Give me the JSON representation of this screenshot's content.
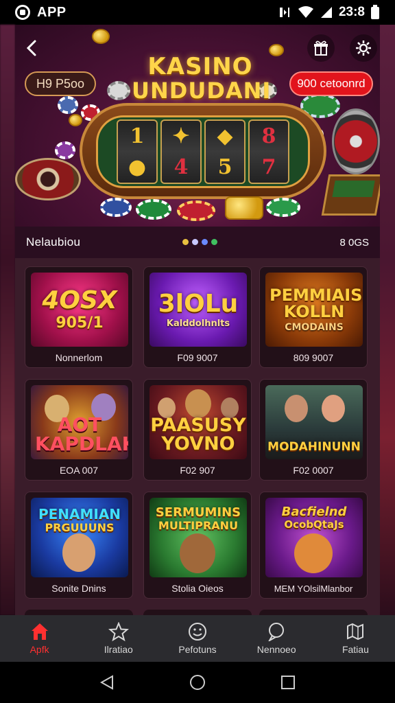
{
  "status_bar": {
    "app_name": "APP",
    "time": "23:8"
  },
  "header": {
    "title_line1": "KASINO",
    "title_line2": "UNDUDANI",
    "pill_left": "H9 P5oo",
    "pill_right": "900 cetoonrd"
  },
  "section": {
    "label": "Nelaubiou",
    "count": "8 0GS",
    "dots": [
      "#e8c040",
      "#c8c8ff",
      "#6a8aff",
      "#40c060"
    ]
  },
  "games": [
    {
      "title": "4OSX",
      "subtitle": "905/1",
      "name": "Nonnerlom"
    },
    {
      "title": "3lOLu",
      "subtitle": "Kalddolhnlts",
      "name": "F09 9007"
    },
    {
      "title": "PEMMIAISN KOLLN",
      "subtitle": "CMODAINS",
      "name": "809 9007"
    },
    {
      "title": "AOT KAPDLAK",
      "subtitle": "",
      "name": "EOA 007"
    },
    {
      "title": "PAASUSY YOVNO",
      "subtitle": "",
      "name": "F02 907"
    },
    {
      "title": "MODAHINUNN",
      "subtitle": "",
      "name": "F02 0007"
    },
    {
      "title": "PENAMIAN",
      "subtitle": "PRGUUUNS",
      "name": "Sonite Dnins"
    },
    {
      "title": "SERMUMINS",
      "subtitle": "MULTIPRANU",
      "name": "Stolia Oieos"
    },
    {
      "title": "Bacfielnd",
      "subtitle": "OcobQtaJs",
      "name": "MEM YOlsilMlanbor"
    }
  ],
  "bottom_nav": [
    {
      "label": "Apfk",
      "icon": "home-icon",
      "active": true
    },
    {
      "label": "Ilratiao",
      "icon": "star-icon",
      "active": false
    },
    {
      "label": "Pefotuns",
      "icon": "smile-icon",
      "active": false
    },
    {
      "label": "Nennoeo",
      "icon": "chat-icon",
      "active": false
    },
    {
      "label": "Fatiau",
      "icon": "map-icon",
      "active": false
    }
  ],
  "colors": {
    "accent": "#ff3030",
    "brand_gold": "#ffd54a",
    "pill_red": "#e2141c"
  }
}
